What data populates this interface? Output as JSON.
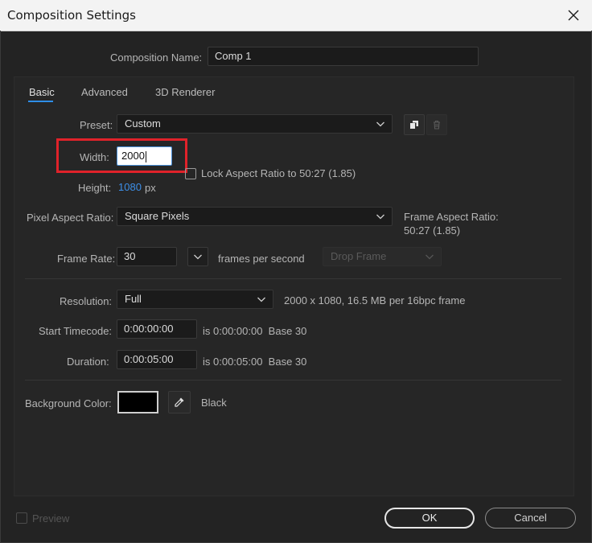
{
  "window": {
    "title": "Composition Settings"
  },
  "comp_name": {
    "label": "Composition Name:",
    "value": "Comp 1"
  },
  "tabs": [
    {
      "label": "Basic",
      "active": true
    },
    {
      "label": "Advanced",
      "active": false
    },
    {
      "label": "3D Renderer",
      "active": false
    }
  ],
  "preset": {
    "label": "Preset:",
    "value": "Custom"
  },
  "width": {
    "label": "Width:",
    "value": "2000"
  },
  "height": {
    "label": "Height:",
    "value": "1080",
    "unit": "px"
  },
  "lock_aspect": {
    "label": "Lock Aspect Ratio to 50:27 (1.85)",
    "checked": false
  },
  "pixel_aspect": {
    "label": "Pixel Aspect Ratio:",
    "value": "Square Pixels"
  },
  "frame_aspect": {
    "label": "Frame Aspect Ratio:",
    "value": "50:27 (1.85)"
  },
  "frame_rate": {
    "label": "Frame Rate:",
    "value": "30",
    "unit": "frames per second",
    "drop_frame": "Drop Frame"
  },
  "resolution": {
    "label": "Resolution:",
    "value": "Full",
    "info": "2000 x 1080, 16.5 MB per 16bpc frame"
  },
  "start_timecode": {
    "label": "Start Timecode:",
    "value": "0:00:00:00",
    "info": "is 0:00:00:00  Base 30"
  },
  "duration": {
    "label": "Duration:",
    "value": "0:00:05:00",
    "info": "is 0:00:05:00  Base 30"
  },
  "background": {
    "label": "Background Color:",
    "color": "#000000",
    "name": "Black"
  },
  "preview": {
    "label": "Preview"
  },
  "buttons": {
    "ok": "OK",
    "cancel": "Cancel"
  },
  "colors": {
    "accent": "#2e8ee8",
    "highlight": "#e0222a"
  }
}
